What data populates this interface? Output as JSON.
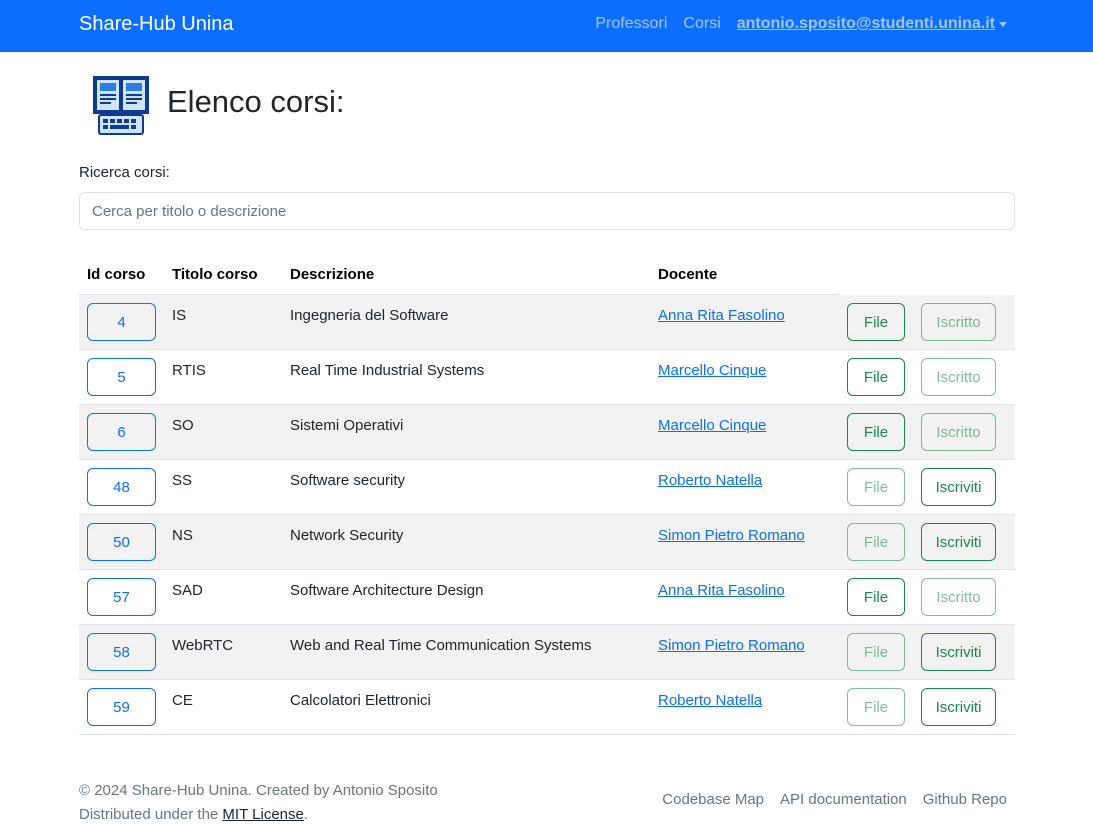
{
  "navbar": {
    "brand": "Share-Hub Unina",
    "links": [
      "Professori",
      "Corsi"
    ],
    "user": "antonio.sposito@studenti.unina.it"
  },
  "header": {
    "title": "Elenco corsi:",
    "icon": "book-keyboard-icon"
  },
  "search": {
    "label": "Ricerca corsi:",
    "placeholder": "Cerca per titolo o descrizione",
    "value": ""
  },
  "table": {
    "columns": [
      "Id corso",
      "Titolo corso",
      "Descrizione",
      "Docente"
    ],
    "rows": [
      {
        "id": "4",
        "title": "IS",
        "description": "Ingegneria del Software",
        "teacher": "Anna Rita Fasolino",
        "file_label": "File",
        "file_enabled": true,
        "enroll_label": "Iscritto",
        "enroll_enabled": false
      },
      {
        "id": "5",
        "title": "RTIS",
        "description": "Real Time Industrial Systems",
        "teacher": "Marcello Cinque",
        "file_label": "File",
        "file_enabled": true,
        "enroll_label": "Iscritto",
        "enroll_enabled": false
      },
      {
        "id": "6",
        "title": "SO",
        "description": "Sistemi Operativi",
        "teacher": "Marcello Cinque",
        "file_label": "File",
        "file_enabled": true,
        "enroll_label": "Iscritto",
        "enroll_enabled": false
      },
      {
        "id": "48",
        "title": "SS",
        "description": "Software security",
        "teacher": "Roberto Natella",
        "file_label": "File",
        "file_enabled": false,
        "enroll_label": "Iscriviti",
        "enroll_enabled": true
      },
      {
        "id": "50",
        "title": "NS",
        "description": "Network Security",
        "teacher": "Simon Pietro Romano",
        "file_label": "File",
        "file_enabled": false,
        "enroll_label": "Iscriviti",
        "enroll_enabled": true
      },
      {
        "id": "57",
        "title": "SAD",
        "description": "Software Architecture Design",
        "teacher": "Anna Rita Fasolino",
        "file_label": "File",
        "file_enabled": true,
        "enroll_label": "Iscritto",
        "enroll_enabled": false
      },
      {
        "id": "58",
        "title": "WebRTC",
        "description": "Web and Real Time Communication Systems",
        "teacher": "Simon Pietro Romano",
        "file_label": "File",
        "file_enabled": false,
        "enroll_label": "Iscriviti",
        "enroll_enabled": true
      },
      {
        "id": "59",
        "title": "CE",
        "description": "Calcolatori Elettronici",
        "teacher": "Roberto Natella",
        "file_label": "File",
        "file_enabled": false,
        "enroll_label": "Iscriviti",
        "enroll_enabled": true
      }
    ]
  },
  "footer": {
    "copyright": "© 2024 Share-Hub Unina. Created by Antonio Sposito",
    "license_prefix": "Distributed under the",
    "license_link": "MIT License",
    "license_suffix": ".",
    "links": [
      "Codebase Map",
      "API documentation",
      "Github Repo"
    ]
  },
  "colors": {
    "primary": "#0d6efd",
    "success": "#198754",
    "stripe": "#f2f2f2"
  }
}
